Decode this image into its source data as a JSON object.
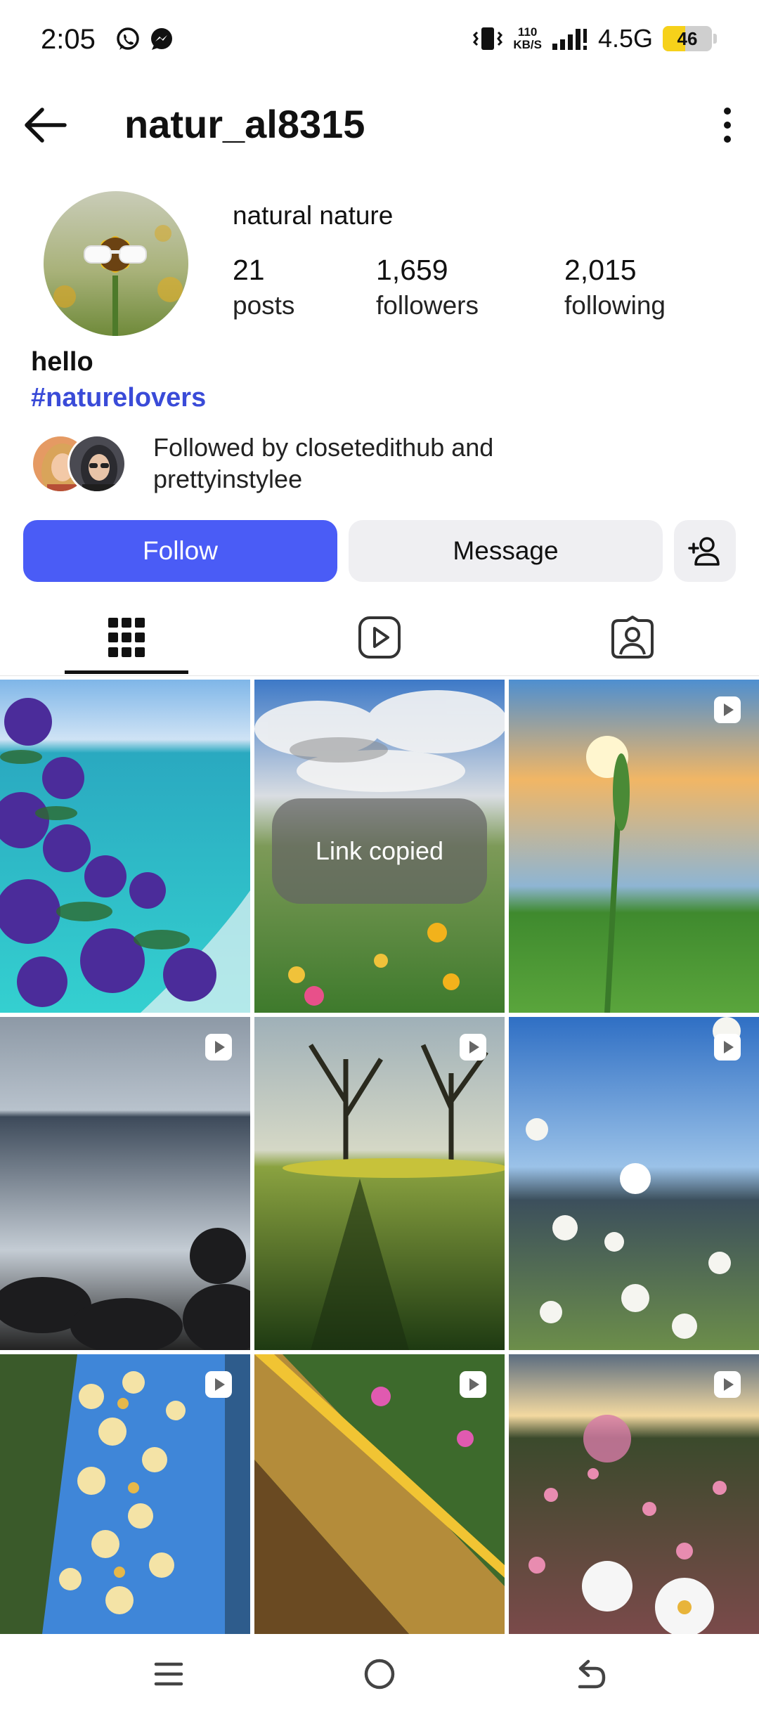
{
  "status_bar": {
    "time": "2:05",
    "speed_value": "110",
    "speed_unit": "KB/S",
    "network": "4.5G",
    "battery": "46",
    "battery_level": 0.46
  },
  "header": {
    "username": "natur_al8315"
  },
  "profile": {
    "display_name": "natural nature",
    "stats": [
      {
        "value": "21",
        "label": "posts"
      },
      {
        "value": "1,659",
        "label": "followers"
      },
      {
        "value": "2,015",
        "label": "following"
      }
    ],
    "bio": "hello",
    "hashtag": "#naturelovers",
    "followed_by_line1": "Followed by closetedithub and",
    "followed_by_line2": "prettyinstylee"
  },
  "actions": {
    "follow": "Follow",
    "message": "Message"
  },
  "tabs": [
    "grid-icon",
    "reels-icon",
    "tagged-icon"
  ],
  "toast": "Link copied",
  "colors": {
    "follow_button": "#4a5cf6",
    "hashtag": "#3a4bd8",
    "secondary_button": "#efeff2"
  }
}
